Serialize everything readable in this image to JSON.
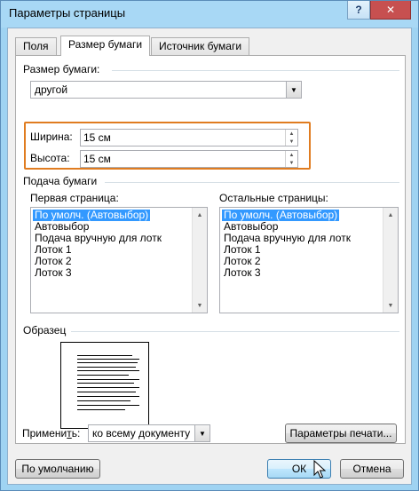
{
  "window": {
    "title": "Параметры страницы",
    "help_glyph": "?",
    "close_glyph": "✕"
  },
  "tabs": [
    {
      "label": "Поля"
    },
    {
      "label": "Размер бумаги"
    },
    {
      "label": "Источник бумаги"
    }
  ],
  "paper_size": {
    "section_label": "Размер бумаги:",
    "selected": "другой",
    "width_label": "Ширина:",
    "width_value": "15 см",
    "height_label": "Высота:",
    "height_value": "15 см"
  },
  "paper_source": {
    "section_label": "Подача бумаги",
    "first_page_label": "Первая страница:",
    "other_pages_label": "Остальные страницы:",
    "first_page_items": [
      "По умолч. (Автовыбор)",
      "Автовыбор",
      "Подача вручную для лотк",
      "Лоток 1",
      "Лоток 2",
      "Лоток 3"
    ],
    "other_pages_items": [
      "По умолч. (Автовыбор)",
      "Автовыбор",
      "Подача вручную для лотк",
      "Лоток 1",
      "Лоток 2",
      "Лоток 3"
    ]
  },
  "sample": {
    "section_label": "Образец"
  },
  "apply": {
    "label": "Применить:",
    "selected": "ко всему документу"
  },
  "buttons": {
    "print_options": "Параметры печати...",
    "default": "По умолчанию",
    "ok": "ОК",
    "cancel": "Отмена"
  },
  "colors": {
    "accent_highlight": "#e07c20",
    "selection": "#3399ff",
    "frame": "#9fd3f2"
  }
}
